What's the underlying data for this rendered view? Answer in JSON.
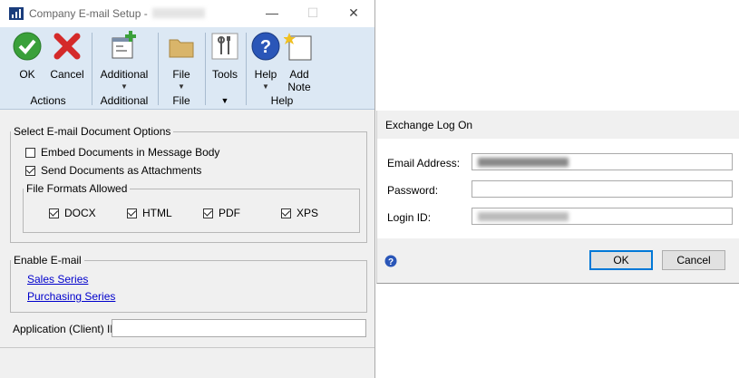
{
  "window": {
    "title": "Company E-mail Setup  -"
  },
  "ribbon": {
    "buttons": [
      {
        "label": "OK"
      },
      {
        "label": "Cancel"
      },
      {
        "label": "Additional"
      },
      {
        "label": "File"
      },
      {
        "label": "Tools"
      },
      {
        "label": "Help"
      },
      {
        "label": "Add",
        "label2": "Note"
      }
    ],
    "groups": [
      "Actions",
      "Additional",
      "File",
      "",
      "Help"
    ]
  },
  "doc_options": {
    "legend": "Select E-mail Document Options",
    "embed": {
      "label": "Embed Documents in Message Body",
      "checked": false
    },
    "attach": {
      "label": "Send Documents as Attachments",
      "checked": true
    },
    "formats_legend": "File Formats Allowed",
    "formats": [
      {
        "label": "DOCX",
        "checked": true
      },
      {
        "label": "HTML",
        "checked": true
      },
      {
        "label": "PDF",
        "checked": true
      },
      {
        "label": "XPS",
        "checked": true
      }
    ]
  },
  "enable_email": {
    "legend": "Enable E-mail",
    "links": [
      "Sales Series",
      "Purchasing Series"
    ]
  },
  "client_id": {
    "label": "Application (Client) ID",
    "value": ""
  },
  "dialog": {
    "title": "Exchange Log On",
    "email_label": "Email Address:",
    "password_label": "Password:",
    "password_value": "",
    "login_label": "Login ID:",
    "ok": "OK",
    "cancel": "Cancel"
  },
  "colors": {
    "ribbon_bg": "#dce8f4",
    "link": "#0000cc",
    "ok_green": "#3aa03a",
    "cancel_red": "#d42a2a",
    "help_blue": "#2a56b8"
  }
}
